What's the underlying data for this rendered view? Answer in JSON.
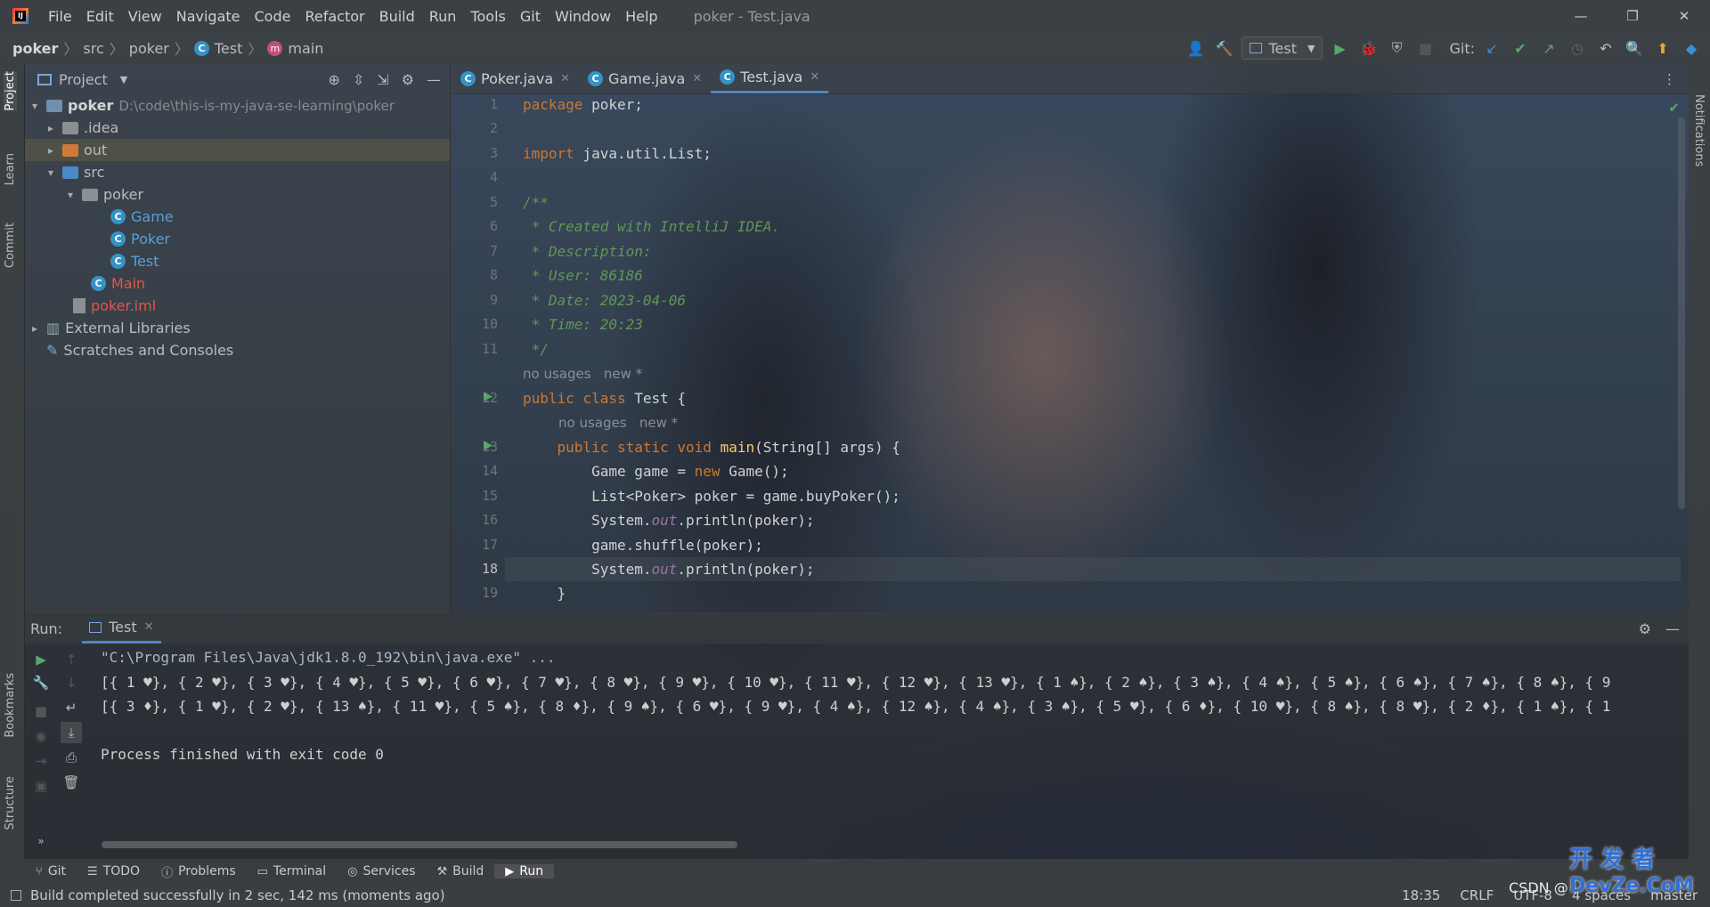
{
  "window": {
    "title": "poker - Test.java",
    "menu": [
      "File",
      "Edit",
      "View",
      "Navigate",
      "Code",
      "Refactor",
      "Build",
      "Run",
      "Tools",
      "Git",
      "Window",
      "Help"
    ]
  },
  "breadcrumb": {
    "items": [
      "poker",
      "src",
      "poker",
      "Test",
      "main"
    ]
  },
  "toolbar": {
    "run_config": "Test",
    "git_label": "Git:"
  },
  "project": {
    "title": "Project",
    "root_name": "poker",
    "root_path": "D:\\code\\this-is-my-java-se-learning\\poker",
    "items": [
      ".idea",
      "out",
      "src",
      "poker",
      "Game",
      "Poker",
      "Test",
      "Main",
      "poker.iml",
      "External Libraries",
      "Scratches and Consoles"
    ]
  },
  "editor": {
    "tabs": [
      "Poker.java",
      "Game.java",
      "Test.java"
    ],
    "line_numbers": [
      "1",
      "2",
      "3",
      "4",
      "5",
      "6",
      "7",
      "8",
      "9",
      "10",
      "11",
      "12",
      "13",
      "14",
      "15",
      "16",
      "17",
      "18",
      "19"
    ],
    "hints": {
      "usages": "no usages",
      "new": "new *"
    },
    "code": {
      "l1a": "package",
      "l1b": " poker;",
      "l3a": "import",
      "l3b": " java.util.List;",
      "l5": "/**",
      "l6": " * Created with IntelliJ IDEA.",
      "l7": " * Description:",
      "l8": " * User: 86186",
      "l9": " * Date: 2023-04-06",
      "l10": " * Time: 20:23",
      "l11": " */",
      "l12a": "public class",
      "l12b": " Test {",
      "l13a": "    public static void ",
      "l13b": "main",
      "l13c": "(String[] args) {",
      "l14a": "        Game game = ",
      "l14b": "new",
      "l14c": " Game();",
      "l15": "        List<Poker> poker = game.buyPoker();",
      "l16a": "        System.",
      "l16b": "out",
      "l16c": ".println(poker);",
      "l17": "        game.shuffle(poker);",
      "l18a": "        System.",
      "l18b": "out",
      "l18c": ".println(poker);",
      "l19": "    }"
    }
  },
  "run": {
    "label": "Run:",
    "tab": "Test",
    "lines": [
      "\"C:\\Program Files\\Java\\jdk1.8.0_192\\bin\\java.exe\" ...",
      "[{ 1 ♥}, { 2 ♥}, { 3 ♥}, { 4 ♥}, { 5 ♥}, { 6 ♥}, { 7 ♥}, { 8 ♥}, { 9 ♥}, { 10 ♥}, { 11 ♥}, { 12 ♥}, { 13 ♥}, { 1 ♠}, { 2 ♠}, { 3 ♠}, { 4 ♠}, { 5 ♠}, { 6 ♠}, { 7 ♠}, { 8 ♠}, { 9",
      "[{ 3 ♦}, { 1 ♥}, { 2 ♥}, { 13 ♠}, { 11 ♥}, { 5 ♠}, { 8 ♦}, { 9 ♠}, { 6 ♥}, { 9 ♥}, { 4 ♠}, { 12 ♠}, { 4 ♠}, { 3 ♠}, { 5 ♥}, { 6 ♦}, { 10 ♥}, { 8 ♠}, { 8 ♥}, { 2 ♦}, { 1 ♠}, { 1",
      "",
      "Process finished with exit code 0"
    ]
  },
  "side_labels": {
    "project": "Project",
    "learn": "Learn",
    "commit": "Commit",
    "bookmarks": "Bookmarks",
    "structure": "Structure",
    "notifications": "Notifications"
  },
  "tool_windows": [
    "Git",
    "TODO",
    "Problems",
    "Terminal",
    "Services",
    "Build",
    "Run"
  ],
  "status": {
    "message": "Build completed successfully in 2 sec, 142 ms (moments ago)",
    "position": "18:35",
    "line_sep": "CRLF",
    "encoding": "UTF-8",
    "indent": "4 spaces",
    "branch": "master",
    "watermark": "CSDN @"
  }
}
